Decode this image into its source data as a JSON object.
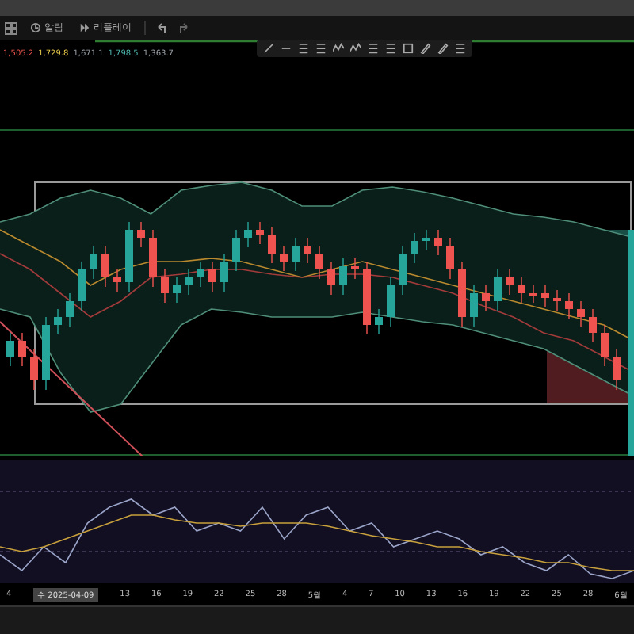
{
  "toolbar": {
    "buttons": [
      {
        "kind": "alert",
        "label": "알림"
      },
      {
        "kind": "replay",
        "label": "리플레이"
      }
    ]
  },
  "legend": {
    "values": [
      {
        "text": "1,505.2",
        "color": "#ef5350"
      },
      {
        "text": "1,729.8",
        "color": "#e6c84a"
      },
      {
        "text": "1,671.1",
        "color": "#9aa0a6"
      },
      {
        "text": "1,798.5",
        "color": "#4db6ac"
      },
      {
        "text": "1,363.7",
        "color": "#9aa0a6"
      }
    ]
  },
  "time_axis": {
    "labels": [
      {
        "kind": "tick",
        "text": "4"
      },
      {
        "kind": "cursor",
        "text": "수 2025-04-09"
      },
      {
        "kind": "tick",
        "text": "13"
      },
      {
        "kind": "tick",
        "text": "16"
      },
      {
        "kind": "tick",
        "text": "19"
      },
      {
        "kind": "tick",
        "text": "22"
      },
      {
        "kind": "tick",
        "text": "25"
      },
      {
        "kind": "tick",
        "text": "28"
      },
      {
        "kind": "tick",
        "text": "5월"
      },
      {
        "kind": "tick",
        "text": "4"
      },
      {
        "kind": "tick",
        "text": "7"
      },
      {
        "kind": "tick",
        "text": "10"
      },
      {
        "kind": "tick",
        "text": "13"
      },
      {
        "kind": "tick",
        "text": "16"
      },
      {
        "kind": "tick",
        "text": "19"
      },
      {
        "kind": "tick",
        "text": "22"
      },
      {
        "kind": "tick",
        "text": "25"
      },
      {
        "kind": "tick",
        "text": "28"
      },
      {
        "kind": "tick",
        "text": "6월"
      }
    ]
  }
}
